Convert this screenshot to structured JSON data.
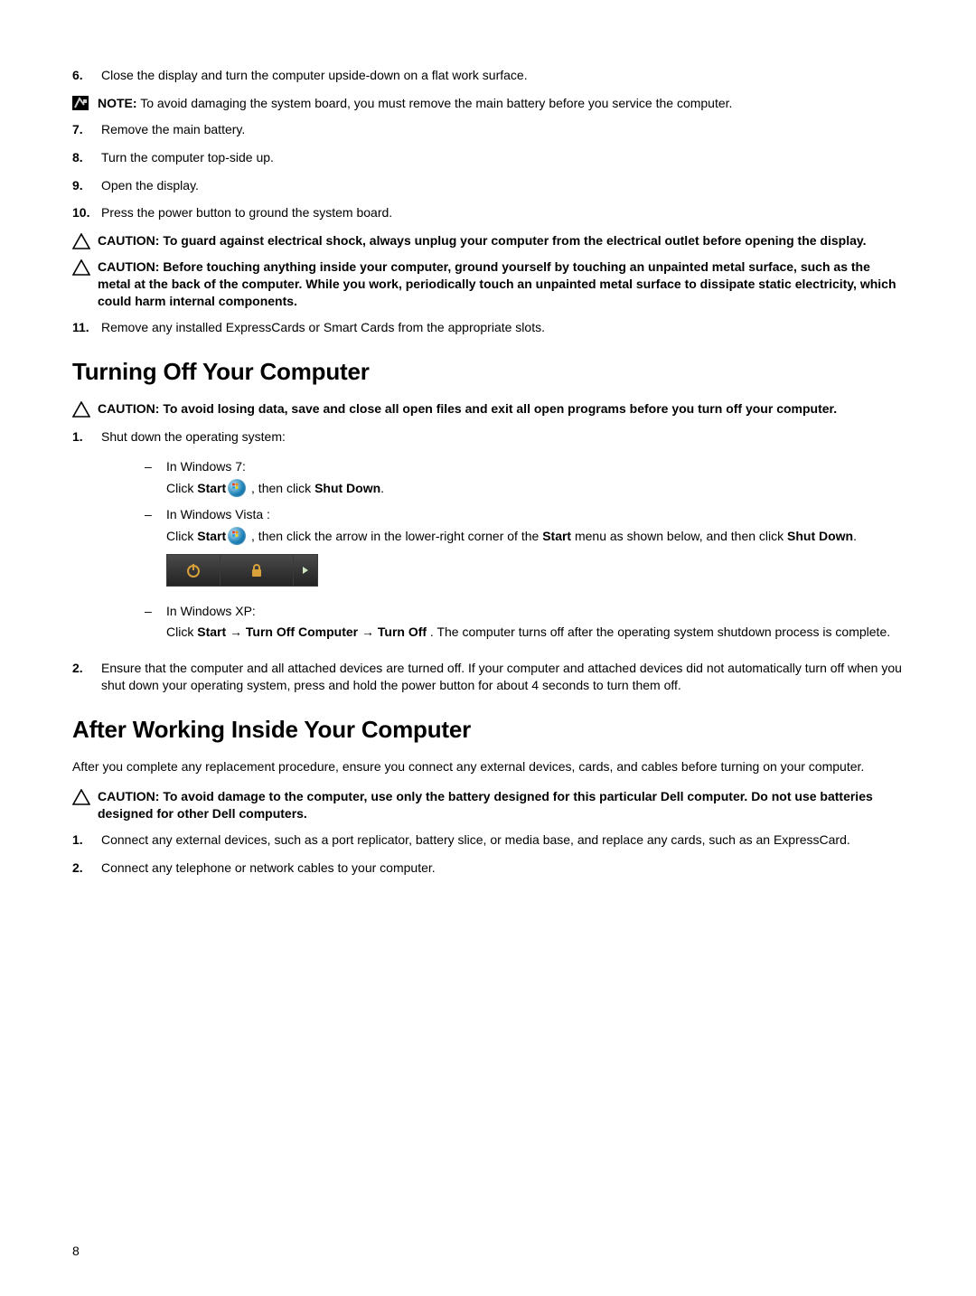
{
  "page_number": "8",
  "steps_a": [
    {
      "num": "6.",
      "text": "Close the display and turn the computer upside-down on a flat work surface."
    }
  ],
  "note1": {
    "label": "NOTE:",
    "text": " To avoid damaging the system board, you must remove the main battery before you service the computer."
  },
  "steps_b": [
    {
      "num": "7.",
      "text": "Remove the main battery."
    },
    {
      "num": "8.",
      "text": "Turn the computer top-side up."
    },
    {
      "num": "9.",
      "text": "Open the display."
    },
    {
      "num": "10.",
      "text": "Press the power button to ground the system board."
    }
  ],
  "caution1": "CAUTION: To guard against electrical shock, always unplug your computer from the electrical outlet before opening the display.",
  "caution2": "CAUTION: Before touching anything inside your computer, ground yourself by touching an unpainted metal surface, such as the metal at the back of the computer. While you work, periodically touch an unpainted metal surface to dissipate static electricity, which could harm internal components.",
  "step11": {
    "num": "11.",
    "text": "Remove any installed ExpressCards or Smart Cards from the appropriate slots."
  },
  "h_turning_off": "Turning Off Your Computer",
  "caution3": "CAUTION: To avoid losing data, save and close all open files and exit all open programs before you turn off your computer.",
  "shutdown": {
    "step1_num": "1.",
    "step1_text": "Shut down the operating system:",
    "win7_label": "In Windows 7:",
    "win7_click": "Click ",
    "win7_start": "Start",
    "win7_then": " , then click ",
    "win7_shutdown": "Shut Down",
    "win7_period": ".",
    "vista_label": "In Windows Vista :",
    "vista_click": "Click ",
    "vista_start": "Start",
    "vista_then1": " , then click the arrow in the lower-right corner of the ",
    "vista_startmenu": "Start",
    "vista_then2": " menu as shown below, and then click ",
    "vista_shutdown": "Shut Down",
    "vista_period": ".",
    "xp_label": "In Windows XP:",
    "xp_click": "Click ",
    "xp_start": "Start",
    "xp_arrow1": " → ",
    "xp_turnoffcomp": "Turn Off Computer",
    "xp_arrow2": " → ",
    "xp_turnoff": "Turn Off",
    "xp_tail": " . The computer turns off after the operating system shutdown process is complete.",
    "step2_num": "2.",
    "step2_text": "Ensure that the computer and all attached devices are turned off. If your computer and attached devices did not automatically turn off when you shut down your operating system, press and hold the power button for about 4 seconds to turn them off."
  },
  "h_after": "After Working Inside Your Computer",
  "after_para": "After you complete any replacement procedure, ensure you connect any external devices, cards, and cables before turning on your computer.",
  "caution4": "CAUTION: To avoid damage to the computer, use only the battery designed for this particular Dell computer. Do not use batteries designed for other Dell computers.",
  "after_steps": [
    {
      "num": "1.",
      "text": "Connect any external devices, such as a port replicator, battery slice, or media base, and replace any cards, such as an ExpressCard."
    },
    {
      "num": "2.",
      "text": "Connect any telephone or network cables to your computer."
    }
  ]
}
